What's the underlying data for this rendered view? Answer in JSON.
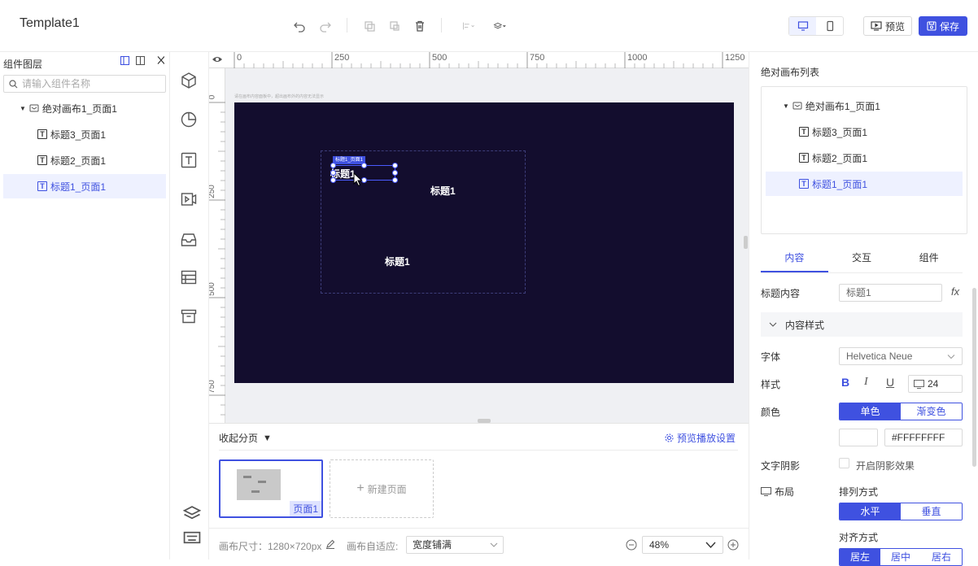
{
  "app": {
    "title": "Template1"
  },
  "toolbar": {
    "preview_label": "预览",
    "save_label": "保存"
  },
  "left_panel": {
    "title": "组件图层",
    "search_placeholder": "请输入组件名称",
    "tree": [
      {
        "label": "绝对画布1_页面1",
        "type": "canvas"
      },
      {
        "label": "标题3_页面1",
        "type": "text"
      },
      {
        "label": "标题2_页面1",
        "type": "text"
      },
      {
        "label": "标题1_页面1",
        "type": "text",
        "selected": true
      }
    ]
  },
  "tools": [
    "cube-icon",
    "pie-chart-icon",
    "text-icon",
    "video-icon",
    "inbox-icon",
    "table-icon",
    "archive-icon",
    "layers-icon",
    "keyboard-icon"
  ],
  "ruler": {
    "top_labels": [
      "0",
      "250",
      "500",
      "750",
      "1000",
      "1250"
    ],
    "left_labels": [
      "0",
      "250",
      "500",
      "750"
    ]
  },
  "canvas": {
    "hint": "请在画布内容面板中，超出画布外的内容无法显示",
    "labels": {
      "selected": "标题1",
      "selected_tag": "标题1_页面1",
      "title_a": "标题1",
      "title_b": "标题1"
    }
  },
  "pages": {
    "collapse_label": "收起分页",
    "preview_settings_label": "预览播放设置",
    "page_name": "页面1",
    "new_page_label": "新建页面"
  },
  "status_bar": {
    "canvas_size_label": "画布尺寸：1280×720px",
    "auto_fit_label": "画布自适应:",
    "auto_fit_value": "宽度铺满",
    "zoom": "48%"
  },
  "right_panel": {
    "list_title": "绝对画布列表",
    "tree": [
      {
        "label": "绝对画布1_页面1",
        "type": "canvas"
      },
      {
        "label": "标题3_页面1",
        "type": "text"
      },
      {
        "label": "标题2_页面1",
        "type": "text"
      },
      {
        "label": "标题1_页面1",
        "type": "text",
        "selected": true
      }
    ],
    "tabs": [
      "内容",
      "交互",
      "组件"
    ],
    "title_content_label": "标题内容",
    "title_content_value": "标题1",
    "fx": "fx",
    "section_label": "内容样式",
    "font_label": "字体",
    "font_value": "Helvetica Neue",
    "style_label": "样式",
    "style_bold": "B",
    "style_italic": "I",
    "style_underline": "U",
    "font_size": "24",
    "color_label": "颜色",
    "color_mode_single": "单色",
    "color_mode_gradient": "渐变色",
    "color_value": "#FFFFFFFF",
    "shadow_label": "文字阴影",
    "shadow_checkbox": "开启阴影效果",
    "layout_label": "布局",
    "arrange_label": "排列方式",
    "arrange_h": "水平",
    "arrange_v": "垂直",
    "align_label": "对齐方式",
    "align_options": [
      "居左",
      "居中",
      "居右"
    ]
  },
  "colors": {
    "accent": "#3f51e0",
    "stage_bg": "#130d2e"
  }
}
